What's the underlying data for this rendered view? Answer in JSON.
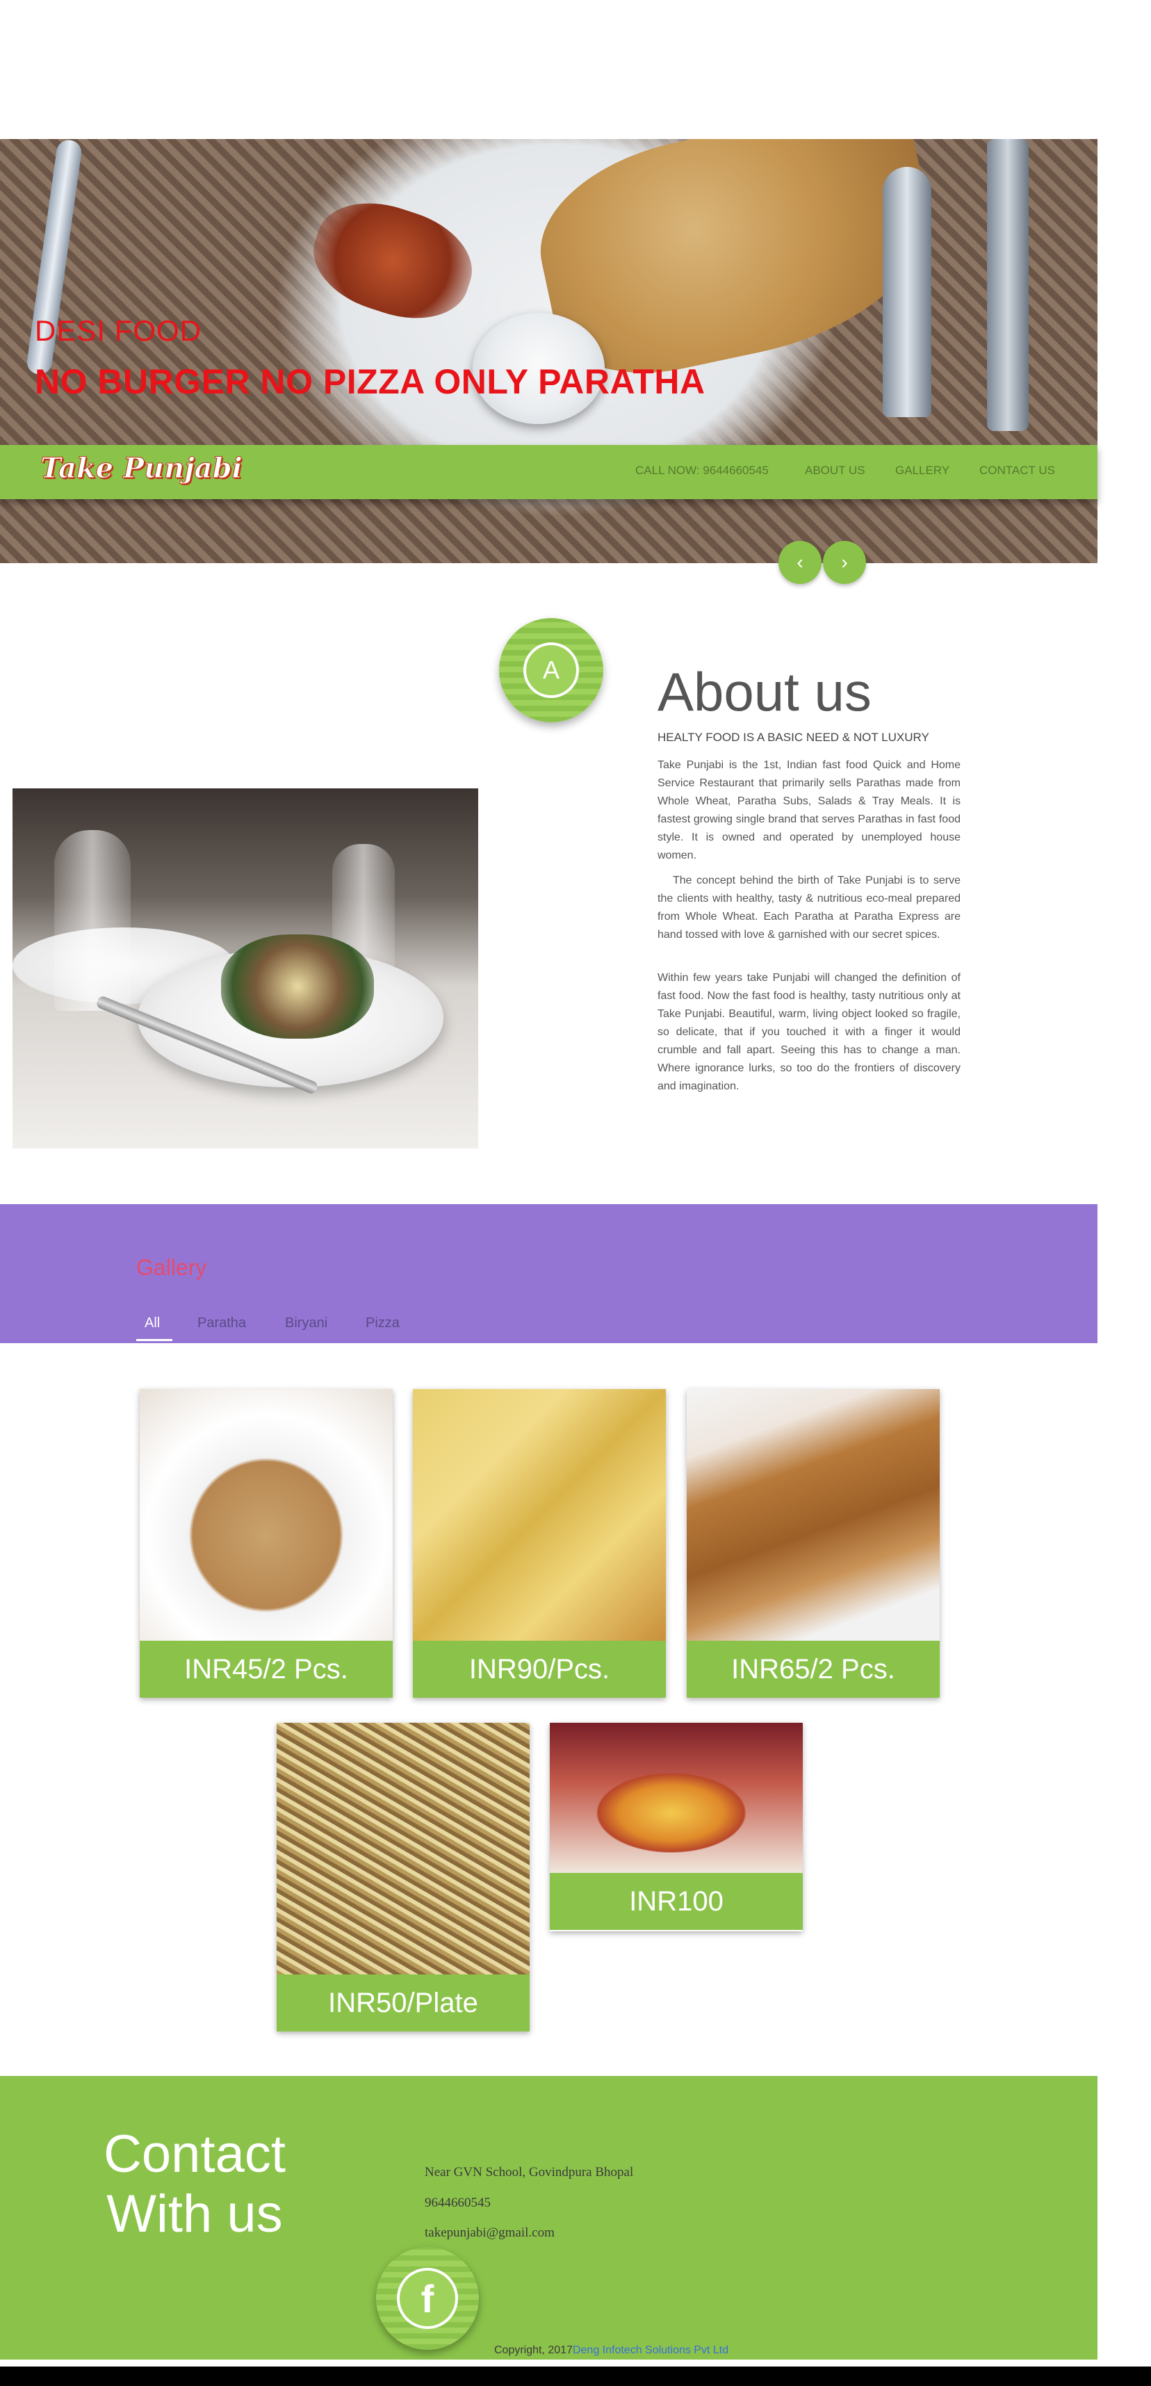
{
  "hero": {
    "subtitle": "DESI FOOD",
    "title": "NO BURGER NO PIZZA ONLY PARATHA",
    "prev_icon": "chevron-left-icon",
    "next_icon": "chevron-right-icon",
    "prev_glyph": "‹",
    "next_glyph": "›"
  },
  "navbar": {
    "brand": "Take Punjabi",
    "links": [
      "CALL NOW: 9644660545",
      "ABOUT US",
      "GALLERY",
      "CONTACT US"
    ],
    "color": "#8bc34a"
  },
  "about": {
    "badge_icon": "letter-a-icon",
    "badge_glyph": "A",
    "heading": "About us",
    "subheading": "HEALTY FOOD IS A BASIC NEED & NOT LUXURY",
    "paragraphs": [
      "Take Punjabi is the 1st, Indian fast food Quick and Home Service Restaurant that primarily sells Parathas made from Whole Wheat, Paratha Subs, Salads & Tray Meals. It is fastest growing single brand that serves Parathas in fast food style. It is owned and operated by unemployed house women.",
      "The concept behind the birth of Take Punjabi is to serve the clients with healthy, tasty & nutritious eco-meal prepared from Whole Wheat. Each Paratha at Paratha Express are hand tossed with love & garnished with our secret spices.",
      "Within few years take Punjabi will changed the definition of fast food. Now the fast food is healthy, tasty nutritious only at Take Punjabi. Beautiful, warm, living object looked so fragile, so delicate, that if you touched it with a finger it would crumble and fall apart. Seeing this has to change a man. Where ignorance lurks, so too do the frontiers of discovery and imagination."
    ]
  },
  "gallery": {
    "title": "Gallery",
    "tabs": [
      "All",
      "Paratha",
      "Biryani",
      "Pizza"
    ],
    "active_tab": "All",
    "band_color": "#9575d4",
    "items": [
      {
        "price": "INR45/2 Pcs."
      },
      {
        "price": "INR90/Pcs."
      },
      {
        "price": "INR65/2 Pcs."
      },
      {
        "price": "INR50/Plate"
      },
      {
        "price": "INR100"
      }
    ]
  },
  "contact": {
    "heading_line1": "Contact",
    "heading_line2": "With us",
    "address": "Near GVN School, Govindpura Bhopal",
    "phone": "9644660545",
    "email": "takepunjabi@gmail.com",
    "social_icon": "facebook-icon",
    "social_glyph": "f",
    "copyright_prefix": "Copyright, 2017",
    "copyright_link": "Deng Infotech Solutions Pvt Ltd"
  }
}
